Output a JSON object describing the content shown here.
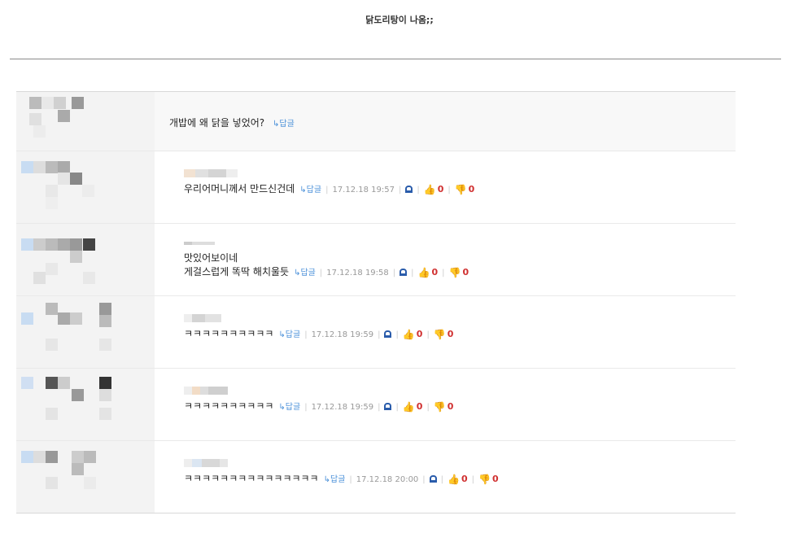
{
  "post": {
    "title": "닭도리탕이 나옴;;"
  },
  "main_comment": {
    "text": "개밥에 왜 닭을 넣었어?",
    "reply_label": "↳답글"
  },
  "replies": [
    {
      "lines": [
        "우리어머니께서 만드신건데"
      ],
      "reply_label": "↳답글",
      "timestamp": "17.12.18 19:57",
      "likes": "0",
      "dislikes": "0"
    },
    {
      "lines": [
        "맛있어보이네",
        "게걸스럽게 똑딱 해치울듯"
      ],
      "reply_label": "↳답글",
      "timestamp": "17.12.18 19:58",
      "likes": "0",
      "dislikes": "0"
    },
    {
      "lines": [
        "ㅋㅋㅋㅋㅋㅋㅋㅋㅋㅋ"
      ],
      "reply_label": "↳답글",
      "timestamp": "17.12.18 19:59",
      "likes": "0",
      "dislikes": "0"
    },
    {
      "lines": [
        "ㅋㅋㅋㅋㅋㅋㅋㅋㅋㅋ"
      ],
      "reply_label": "↳답글",
      "timestamp": "17.12.18 19:59",
      "likes": "0",
      "dislikes": "0"
    },
    {
      "lines": [
        "ㅋㅋㅋㅋㅋㅋㅋㅋㅋㅋㅋㅋㅋㅋㅋ"
      ],
      "reply_label": "↳답글",
      "timestamp": "17.12.18 20:00",
      "likes": "0",
      "dislikes": "0"
    }
  ],
  "icons": {
    "report": "bell-icon",
    "like": "thumbs-up-icon",
    "dislike": "thumbs-down-icon"
  },
  "colors": {
    "reply_link": "#4a90d9",
    "vote_count": "#d03030",
    "icon_blue": "#2a5cab"
  }
}
